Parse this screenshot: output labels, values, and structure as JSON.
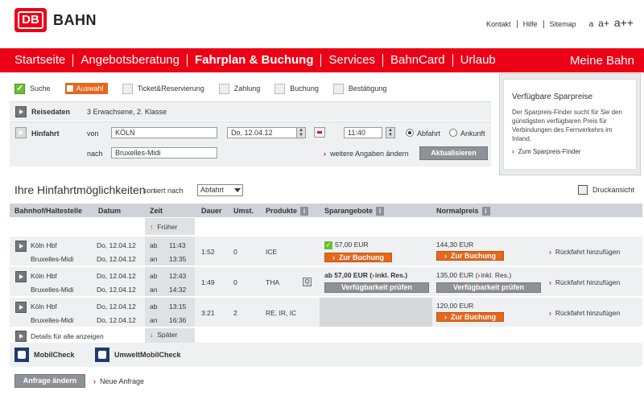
{
  "header": {
    "logo_text": "DB",
    "brand": "BAHN",
    "links": [
      "Kontakt",
      "Hilfe",
      "Sitemap"
    ],
    "font_sizes": [
      "a",
      "a+",
      "a++"
    ]
  },
  "nav": {
    "items": [
      "Startseite",
      "Angebotsberatung",
      "Fahrplan & Buchung",
      "Services",
      "BahnCard",
      "Urlaub"
    ],
    "right": "Meine Bahn"
  },
  "steps": [
    "Suche",
    "Auswahl",
    "Ticket&Reservierung",
    "Zahlung",
    "Buchung",
    "Bestätigung"
  ],
  "reise": {
    "label": "Reisedaten",
    "value": "3 Erwachsene, 2. Klasse"
  },
  "hinfahrt": {
    "label": "Hinfahrt",
    "von_label": "von",
    "von_value": "KÖLN",
    "nach_label": "nach",
    "nach_value": "Bruxelles-Midi",
    "date_value": "Do, 12.04.12",
    "time_value": "11:40",
    "abfahrt": "Abfahrt",
    "ankunft": "Ankunft",
    "more_link": "weitere Angaben ändern",
    "update_button": "Aktualisieren"
  },
  "sidebox": {
    "title": "Verfügbare Sparpreise",
    "text": "Der Sparpreis-Finder sucht für Sie den günstigsten verfügbaren Preis für Verbindungen des Fernverkehrs im Inland.",
    "link": "Zum Sparpreis-Finder"
  },
  "results": {
    "title": "Ihre Hinfahrtmöglichkeiten",
    "dash": "-",
    "sort_label": "sortiert nach",
    "sort_value": "Abfahrt",
    "print": "Druckansicht",
    "columns": [
      "Bahnhof/Haltestelle",
      "Datum",
      "Zeit",
      "Dauer",
      "Umst.",
      "Produkte",
      "Sparangebote",
      "Normalpreis"
    ],
    "earlier": "Früher",
    "later": "Später",
    "details_all": "Details für alle anzeigen",
    "ab": "ab",
    "an": "an",
    "rueckfahrt": "Rückfahrt hinzufügen",
    "book": "Zur Buchung",
    "check": "Verfügbarkeit prüfen",
    "inkl": "inkl. Res.)",
    "rows": [
      {
        "from": "Köln Hbf",
        "to": "Bruxelles-Midi",
        "date1": "Do, 12.04.12",
        "date2": "Do, 12.04.12",
        "dep": "11:43",
        "arr": "13:35",
        "duration": "1:52",
        "changes": "0",
        "products": "ICE",
        "spar": "57,00 EUR",
        "normal": "144,30 EUR"
      },
      {
        "from": "Köln Hbf",
        "to": "Bruxelles-Midi",
        "date1": "Do, 12.04.12",
        "date2": "Do, 12.04.12",
        "dep": "12:43",
        "arr": "14:32",
        "duration": "1:49",
        "changes": "0",
        "products": "THA",
        "spar": "ab 57,00 EUR",
        "normal": "135,00 EUR"
      },
      {
        "from": "Köln Hbf",
        "to": "Bruxelles-Midi",
        "date1": "Do, 12.04.12",
        "date2": "Do, 12.04.12",
        "dep": "13:15",
        "arr": "16:36",
        "duration": "3:21",
        "changes": "2",
        "products": "RE, IR, IC",
        "spar": "",
        "normal": "120,00 EUR"
      }
    ]
  },
  "bottom": {
    "mobilcheck": "MobilCheck",
    "umwelt": "UmweltMobilCheck",
    "change_button": "Anfrage ändern",
    "new_request": "Neue Anfrage"
  },
  "colors": {
    "db_red": "#ec0016",
    "orange": "#e6671e",
    "gray_button": "#8e9195"
  }
}
